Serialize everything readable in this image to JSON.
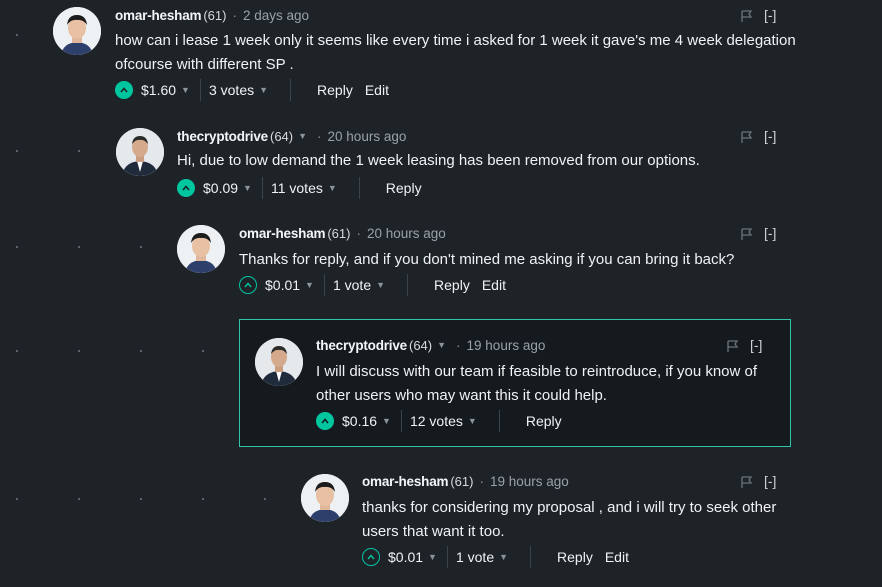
{
  "comments": [
    {
      "author": "omar-hesham",
      "reputation": "(61)",
      "separator": "·",
      "time": "2 days ago",
      "body": "how can i lease 1 week only it seems like every time i asked for 1 week it gave's me 4 week delegation ofcourse with different SP .",
      "payout": "$1.60",
      "votes": "3 votes",
      "reply_label": "Reply",
      "edit_label": "Edit",
      "collapse_label": "[-]"
    },
    {
      "author": "thecryptodrive",
      "reputation": "(64)",
      "separator": "·",
      "time": "20 hours ago",
      "body": "Hi, due to low demand the 1 week leasing has been removed from our options.",
      "payout": "$0.09",
      "votes": "11 votes",
      "reply_label": "Reply",
      "collapse_label": "[-]"
    },
    {
      "author": "omar-hesham",
      "reputation": "(61)",
      "separator": "·",
      "time": "20 hours ago",
      "body": "Thanks for reply, and if you don't mined me asking if you can bring it back?",
      "payout": "$0.01",
      "votes": "1 vote",
      "reply_label": "Reply",
      "edit_label": "Edit",
      "collapse_label": "[-]"
    },
    {
      "author": "thecryptodrive",
      "reputation": "(64)",
      "separator": "·",
      "time": "19 hours ago",
      "body": "I will discuss with our team if feasible to reintroduce, if you know of other users who may want this it could help.",
      "payout": "$0.16",
      "votes": "12 votes",
      "reply_label": "Reply",
      "collapse_label": "[-]"
    },
    {
      "author": "omar-hesham",
      "reputation": "(61)",
      "separator": "·",
      "time": "19 hours ago",
      "body": "thanks for considering my proposal , and i will try to seek other users that want it too.",
      "payout": "$0.01",
      "votes": "1 vote",
      "reply_label": "Reply",
      "edit_label": "Edit",
      "collapse_label": "[-]"
    }
  ],
  "icons": {
    "upvote": "chevron-up-icon",
    "flag": "flag-icon",
    "dropdown": "caret-down-icon"
  },
  "colors": {
    "background": "#1e2328",
    "accent": "#00c6a0",
    "highlight_border": "#2fc4a6"
  }
}
